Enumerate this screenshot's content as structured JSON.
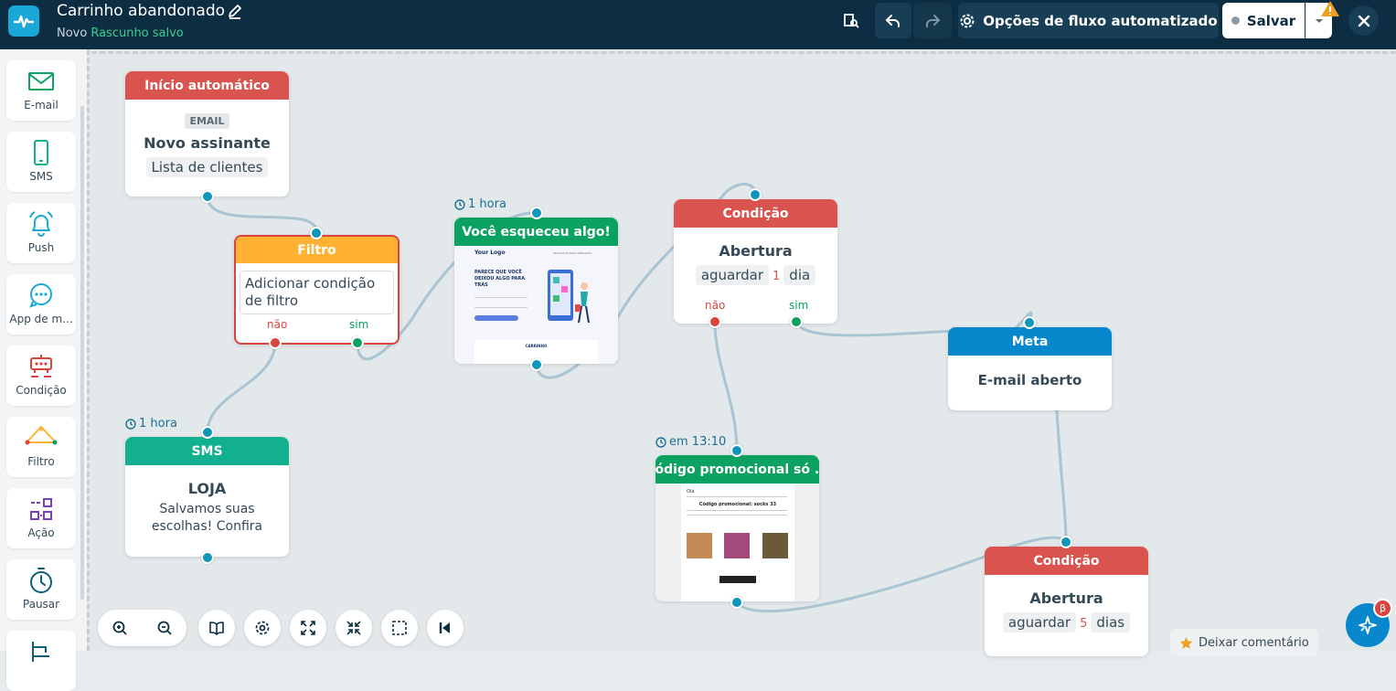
{
  "header": {
    "title": "Carrinho abandonado",
    "status_new": "Novo",
    "status_saved": "Rascunho salvo",
    "options_label": "Opções de fluxo automatizado",
    "save_label": "Salvar"
  },
  "sidebar": {
    "items": [
      {
        "label": "E-mail",
        "icon": "mail-icon"
      },
      {
        "label": "SMS",
        "icon": "phone-icon"
      },
      {
        "label": "Push",
        "icon": "bell-icon"
      },
      {
        "label": "App de m...",
        "icon": "chat-icon"
      },
      {
        "label": "Condição",
        "icon": "condition-icon"
      },
      {
        "label": "Filtro",
        "icon": "filter-icon"
      },
      {
        "label": "Ação",
        "icon": "action-icon"
      },
      {
        "label": "Pausar",
        "icon": "timer-icon"
      }
    ]
  },
  "nodes": {
    "start": {
      "header": "Início automático",
      "badge": "EMAIL",
      "title": "Novo assinante",
      "chip": "Lista de clientes"
    },
    "filter": {
      "header": "Filtro",
      "placeholder": "Adicionar condição de filtro",
      "no": "não",
      "yes": "sim"
    },
    "email1": {
      "delay": "1 hora",
      "header": "Você esqueceu algo!",
      "logo": "Your Logo",
      "nav": "PRODUTOS MAIS VENDIDOS",
      "headline": "PARECE QUE VOCÊ DEIXOU ALGO PARA TRÁS",
      "cart": "CARRINHO"
    },
    "cond1": {
      "header": "Condição",
      "title": "Abertura",
      "wait": "aguardar",
      "num": "1",
      "unit": "dia",
      "no": "não",
      "yes": "sim"
    },
    "sms": {
      "delay": "1 hora",
      "header": "SMS",
      "title": "LOJA",
      "text": "Salvamos suas escolhas! Confira em..."
    },
    "meta": {
      "header": "Meta",
      "title": "E-mail aberto"
    },
    "promo": {
      "delay": "em 13:10",
      "header": "Código promocional só ...",
      "greeting": "Olá",
      "code": "Código promocional: socks 33"
    },
    "cond2": {
      "header": "Condição",
      "title": "Abertura",
      "wait": "aguardar",
      "num": "5",
      "unit": "dias"
    }
  },
  "footer": {
    "comment_label": "Deixar comentário",
    "beta": "β"
  }
}
